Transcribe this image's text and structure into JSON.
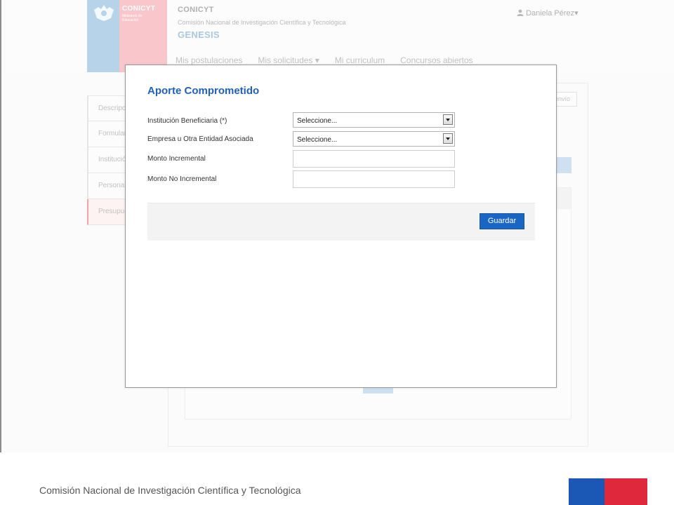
{
  "header": {
    "logo_brand": "CONICYT",
    "logo_ministry": "Ministerio de Educación",
    "org_short": "CONICYT",
    "org_full": "Comisión Nacional de Investigación Científica y Tecnológica",
    "app_name": "GENESIS",
    "user_name": "Daniela Pérez",
    "user_icon": "user-icon",
    "user_caret": "▾"
  },
  "nav": {
    "items": [
      {
        "label": "Mis postulaciones"
      },
      {
        "label": "Mis solicitudes",
        "caret": "▾"
      },
      {
        "label": "Mi curriculum"
      },
      {
        "label": "Concursos abiertos"
      }
    ]
  },
  "sidebar": {
    "items": [
      {
        "label": "Descripción"
      },
      {
        "label": "Formulario"
      },
      {
        "label": "Institución"
      },
      {
        "label": "Personal"
      },
      {
        "label": "Presupuesto"
      }
    ]
  },
  "content": {
    "envio_label": "envío"
  },
  "modal": {
    "title": "Aporte Comprometido",
    "fields": [
      {
        "label": "Institución Beneficiaria (*)",
        "type": "select",
        "value": "Seleccione..."
      },
      {
        "label": "Empresa u Otra Entidad Asociada",
        "type": "select",
        "value": "Seleccione..."
      },
      {
        "label": "Monto Incremental",
        "type": "text",
        "value": ""
      },
      {
        "label": "Monto No Incremental",
        "type": "text",
        "value": ""
      }
    ],
    "save_label": "Guardar"
  },
  "footer": {
    "text": "Comisión Nacional de Investigación Científica y Tecnológica"
  },
  "colors": {
    "accent": "#1a66c5",
    "title": "#2060b8",
    "flag_blue": "#1b58b6",
    "flag_red": "#e0283c"
  }
}
